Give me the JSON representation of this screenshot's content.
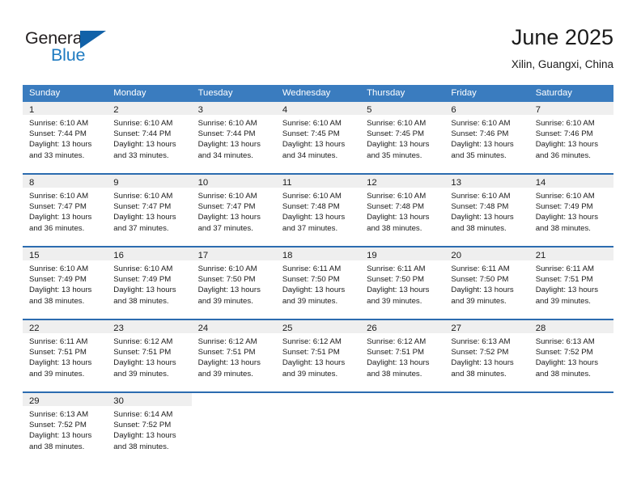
{
  "brand": {
    "name_top": "General",
    "name_bottom": "Blue",
    "triangle_color": "#1262a8",
    "top_color": "#231f20",
    "bottom_color": "#1f7bc1"
  },
  "header": {
    "title": "June 2025",
    "subtitle": "Xilin, Guangxi, China"
  },
  "colors": {
    "header_row_bg": "#3a7cbf",
    "row_separator": "#2c6cb0",
    "day_band_bg": "#efefef",
    "text": "#1b1b1b"
  },
  "weekdays": [
    "Sunday",
    "Monday",
    "Tuesday",
    "Wednesday",
    "Thursday",
    "Friday",
    "Saturday"
  ],
  "weeks": [
    {
      "days": [
        {
          "day": "1",
          "sunrise": "Sunrise: 6:10 AM",
          "sunset": "Sunset: 7:44 PM",
          "daylight1": "Daylight: 13 hours",
          "daylight2": "and 33 minutes."
        },
        {
          "day": "2",
          "sunrise": "Sunrise: 6:10 AM",
          "sunset": "Sunset: 7:44 PM",
          "daylight1": "Daylight: 13 hours",
          "daylight2": "and 33 minutes."
        },
        {
          "day": "3",
          "sunrise": "Sunrise: 6:10 AM",
          "sunset": "Sunset: 7:44 PM",
          "daylight1": "Daylight: 13 hours",
          "daylight2": "and 34 minutes."
        },
        {
          "day": "4",
          "sunrise": "Sunrise: 6:10 AM",
          "sunset": "Sunset: 7:45 PM",
          "daylight1": "Daylight: 13 hours",
          "daylight2": "and 34 minutes."
        },
        {
          "day": "5",
          "sunrise": "Sunrise: 6:10 AM",
          "sunset": "Sunset: 7:45 PM",
          "daylight1": "Daylight: 13 hours",
          "daylight2": "and 35 minutes."
        },
        {
          "day": "6",
          "sunrise": "Sunrise: 6:10 AM",
          "sunset": "Sunset: 7:46 PM",
          "daylight1": "Daylight: 13 hours",
          "daylight2": "and 35 minutes."
        },
        {
          "day": "7",
          "sunrise": "Sunrise: 6:10 AM",
          "sunset": "Sunset: 7:46 PM",
          "daylight1": "Daylight: 13 hours",
          "daylight2": "and 36 minutes."
        }
      ]
    },
    {
      "days": [
        {
          "day": "8",
          "sunrise": "Sunrise: 6:10 AM",
          "sunset": "Sunset: 7:47 PM",
          "daylight1": "Daylight: 13 hours",
          "daylight2": "and 36 minutes."
        },
        {
          "day": "9",
          "sunrise": "Sunrise: 6:10 AM",
          "sunset": "Sunset: 7:47 PM",
          "daylight1": "Daylight: 13 hours",
          "daylight2": "and 37 minutes."
        },
        {
          "day": "10",
          "sunrise": "Sunrise: 6:10 AM",
          "sunset": "Sunset: 7:47 PM",
          "daylight1": "Daylight: 13 hours",
          "daylight2": "and 37 minutes."
        },
        {
          "day": "11",
          "sunrise": "Sunrise: 6:10 AM",
          "sunset": "Sunset: 7:48 PM",
          "daylight1": "Daylight: 13 hours",
          "daylight2": "and 37 minutes."
        },
        {
          "day": "12",
          "sunrise": "Sunrise: 6:10 AM",
          "sunset": "Sunset: 7:48 PM",
          "daylight1": "Daylight: 13 hours",
          "daylight2": "and 38 minutes."
        },
        {
          "day": "13",
          "sunrise": "Sunrise: 6:10 AM",
          "sunset": "Sunset: 7:48 PM",
          "daylight1": "Daylight: 13 hours",
          "daylight2": "and 38 minutes."
        },
        {
          "day": "14",
          "sunrise": "Sunrise: 6:10 AM",
          "sunset": "Sunset: 7:49 PM",
          "daylight1": "Daylight: 13 hours",
          "daylight2": "and 38 minutes."
        }
      ]
    },
    {
      "days": [
        {
          "day": "15",
          "sunrise": "Sunrise: 6:10 AM",
          "sunset": "Sunset: 7:49 PM",
          "daylight1": "Daylight: 13 hours",
          "daylight2": "and 38 minutes."
        },
        {
          "day": "16",
          "sunrise": "Sunrise: 6:10 AM",
          "sunset": "Sunset: 7:49 PM",
          "daylight1": "Daylight: 13 hours",
          "daylight2": "and 38 minutes."
        },
        {
          "day": "17",
          "sunrise": "Sunrise: 6:10 AM",
          "sunset": "Sunset: 7:50 PM",
          "daylight1": "Daylight: 13 hours",
          "daylight2": "and 39 minutes."
        },
        {
          "day": "18",
          "sunrise": "Sunrise: 6:11 AM",
          "sunset": "Sunset: 7:50 PM",
          "daylight1": "Daylight: 13 hours",
          "daylight2": "and 39 minutes."
        },
        {
          "day": "19",
          "sunrise": "Sunrise: 6:11 AM",
          "sunset": "Sunset: 7:50 PM",
          "daylight1": "Daylight: 13 hours",
          "daylight2": "and 39 minutes."
        },
        {
          "day": "20",
          "sunrise": "Sunrise: 6:11 AM",
          "sunset": "Sunset: 7:50 PM",
          "daylight1": "Daylight: 13 hours",
          "daylight2": "and 39 minutes."
        },
        {
          "day": "21",
          "sunrise": "Sunrise: 6:11 AM",
          "sunset": "Sunset: 7:51 PM",
          "daylight1": "Daylight: 13 hours",
          "daylight2": "and 39 minutes."
        }
      ]
    },
    {
      "days": [
        {
          "day": "22",
          "sunrise": "Sunrise: 6:11 AM",
          "sunset": "Sunset: 7:51 PM",
          "daylight1": "Daylight: 13 hours",
          "daylight2": "and 39 minutes."
        },
        {
          "day": "23",
          "sunrise": "Sunrise: 6:12 AM",
          "sunset": "Sunset: 7:51 PM",
          "daylight1": "Daylight: 13 hours",
          "daylight2": "and 39 minutes."
        },
        {
          "day": "24",
          "sunrise": "Sunrise: 6:12 AM",
          "sunset": "Sunset: 7:51 PM",
          "daylight1": "Daylight: 13 hours",
          "daylight2": "and 39 minutes."
        },
        {
          "day": "25",
          "sunrise": "Sunrise: 6:12 AM",
          "sunset": "Sunset: 7:51 PM",
          "daylight1": "Daylight: 13 hours",
          "daylight2": "and 39 minutes."
        },
        {
          "day": "26",
          "sunrise": "Sunrise: 6:12 AM",
          "sunset": "Sunset: 7:51 PM",
          "daylight1": "Daylight: 13 hours",
          "daylight2": "and 38 minutes."
        },
        {
          "day": "27",
          "sunrise": "Sunrise: 6:13 AM",
          "sunset": "Sunset: 7:52 PM",
          "daylight1": "Daylight: 13 hours",
          "daylight2": "and 38 minutes."
        },
        {
          "day": "28",
          "sunrise": "Sunrise: 6:13 AM",
          "sunset": "Sunset: 7:52 PM",
          "daylight1": "Daylight: 13 hours",
          "daylight2": "and 38 minutes."
        }
      ]
    },
    {
      "days": [
        {
          "day": "29",
          "sunrise": "Sunrise: 6:13 AM",
          "sunset": "Sunset: 7:52 PM",
          "daylight1": "Daylight: 13 hours",
          "daylight2": "and 38 minutes."
        },
        {
          "day": "30",
          "sunrise": "Sunrise: 6:14 AM",
          "sunset": "Sunset: 7:52 PM",
          "daylight1": "Daylight: 13 hours",
          "daylight2": "and 38 minutes."
        },
        {
          "day": "",
          "sunrise": "",
          "sunset": "",
          "daylight1": "",
          "daylight2": ""
        },
        {
          "day": "",
          "sunrise": "",
          "sunset": "",
          "daylight1": "",
          "daylight2": ""
        },
        {
          "day": "",
          "sunrise": "",
          "sunset": "",
          "daylight1": "",
          "daylight2": ""
        },
        {
          "day": "",
          "sunrise": "",
          "sunset": "",
          "daylight1": "",
          "daylight2": ""
        },
        {
          "day": "",
          "sunrise": "",
          "sunset": "",
          "daylight1": "",
          "daylight2": ""
        }
      ]
    }
  ]
}
